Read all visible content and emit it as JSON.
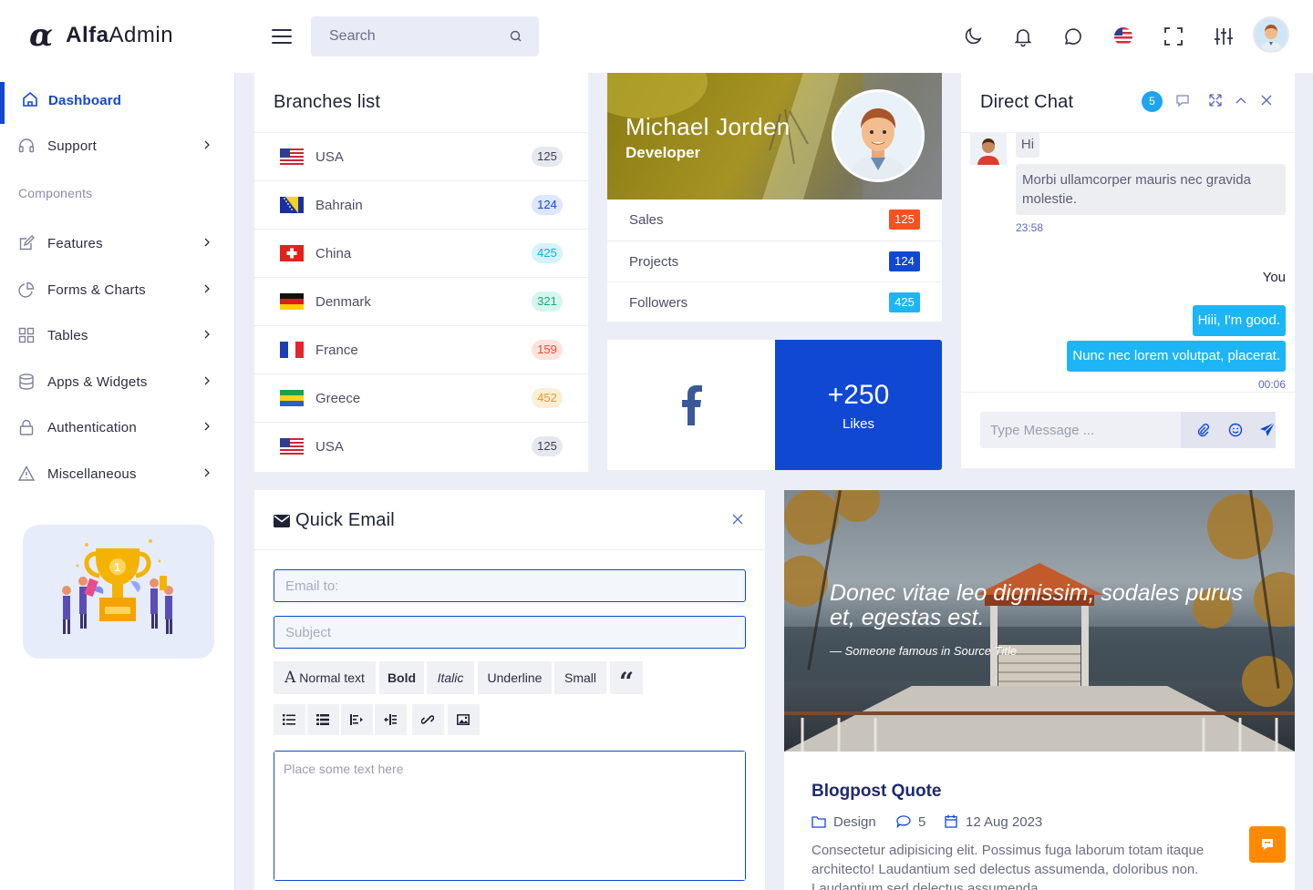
{
  "brand": {
    "mark": "α",
    "name_bold": "Alfa",
    "name_rest": "Admin"
  },
  "header": {
    "search_placeholder": "Search"
  },
  "sidebar": {
    "items": [
      {
        "label": "Dashboard"
      },
      {
        "label": "Support"
      },
      {
        "label": "Features"
      },
      {
        "label": "Forms & Charts"
      },
      {
        "label": "Tables"
      },
      {
        "label": "Apps & Widgets"
      },
      {
        "label": "Authentication"
      },
      {
        "label": "Miscellaneous"
      }
    ],
    "section_components": "Components"
  },
  "branches": {
    "title": "Branches list",
    "rows": [
      {
        "name": "USA",
        "count": "125",
        "flag": "usa",
        "badge_bg": "#e6e8ef",
        "badge_fg": "#3b3e56"
      },
      {
        "name": "Bahrain",
        "count": "124",
        "flag": "bosnia",
        "badge_bg": "#dde6fb",
        "badge_fg": "#1048d4"
      },
      {
        "name": "China",
        "count": "425",
        "flag": "swiss",
        "badge_bg": "#d4f3fb",
        "badge_fg": "#12b0e6"
      },
      {
        "name": "Denmark",
        "count": "321",
        "flag": "germany",
        "badge_bg": "#d6f5ec",
        "badge_fg": "#17a782"
      },
      {
        "name": "France",
        "count": "159",
        "flag": "france",
        "badge_bg": "#fde3dc",
        "badge_fg": "#f04a24"
      },
      {
        "name": "Greece",
        "count": "452",
        "flag": "gabon",
        "badge_bg": "#fdeed6",
        "badge_fg": "#f09a1c"
      },
      {
        "name": "USA",
        "count": "125",
        "flag": "usa",
        "badge_bg": "#e6e8ef",
        "badge_fg": "#3b3e56"
      }
    ]
  },
  "profile": {
    "name": "Michael Jorden",
    "role": "Developer",
    "stats": [
      {
        "label": "Sales",
        "value": "125",
        "color": "#f5521f"
      },
      {
        "label": "Projects",
        "value": "124",
        "color": "#1048d4"
      },
      {
        "label": "Followers",
        "value": "425",
        "color": "#1db5f5"
      }
    ]
  },
  "social": {
    "likes_count": "+250",
    "likes_label": "Likes"
  },
  "chat": {
    "title": "Direct Chat",
    "unread": "5",
    "msg1": "Hi",
    "msg2": "Morbi ullamcorper mauris nec gravida molestie.",
    "time1": "23:58",
    "me_label": "You",
    "msg3": "Hiii, I'm good.",
    "msg4": "Nunc nec lorem volutpat, placerat.",
    "time2": "00:06",
    "input_placeholder": "Type Message ..."
  },
  "email": {
    "title": "Quick Email",
    "to_placeholder": "Email to:",
    "subject_placeholder": "Subject",
    "fmt_normal": "Normal text",
    "fmt_normal_glyph": "A",
    "fmt_bold": "Bold",
    "fmt_italic": "Italic",
    "fmt_underline": "Underline",
    "fmt_small": "Small",
    "fmt_quote": "“",
    "body_placeholder": "Place some text here"
  },
  "blog": {
    "quote": "Donec vitae leo dignissim, sodales purus et, egestas est.",
    "cite": "— Someone famous in Source Title",
    "title": "Blogpost Quote",
    "category": "Design",
    "comments": "5",
    "date": "12 Aug 2023",
    "text": "Consectetur adipisicing elit. Possimus fuga laborum totam itaque architecto! Laudantium sed delectus assumenda, doloribus non. Laudantium sed delectus assumenda"
  }
}
